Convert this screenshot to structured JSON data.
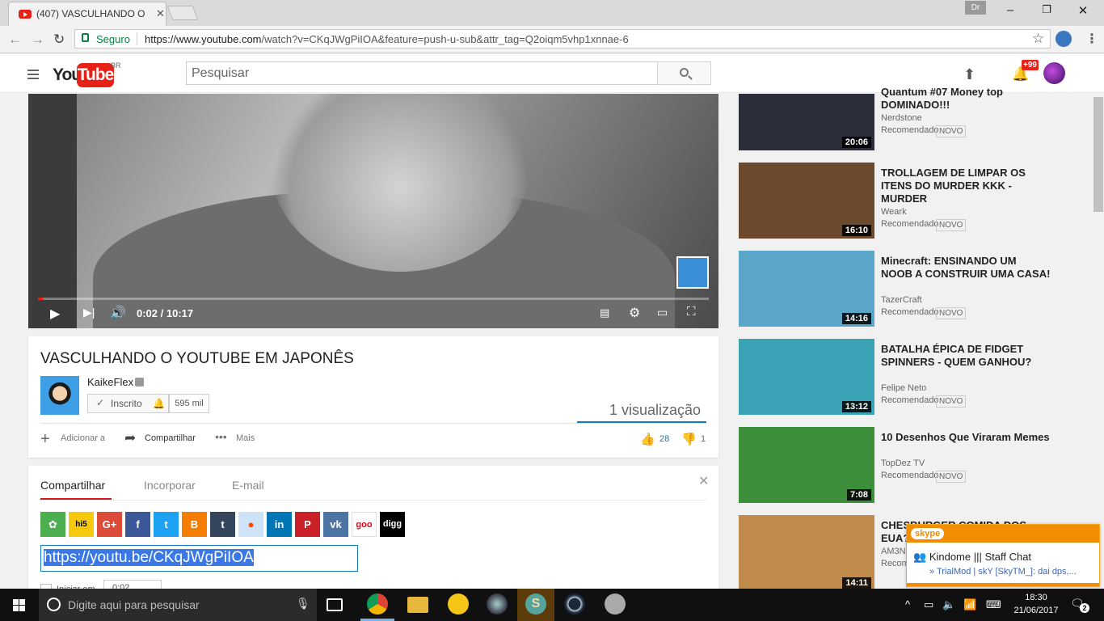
{
  "browser": {
    "tab_title": "(407) VASCULHANDO O",
    "profile": "Dr",
    "secure_label": "Seguro",
    "url_scheme_host": "https://www.youtube.com",
    "url_rest": "/watch?v=CKqJWgPiIOA&feature=push-u-sub&attr_tag=Q2oiqm5vhp1xnnae-6",
    "icons": [
      "youtube-favicon",
      "back-icon",
      "forward-icon",
      "reload-icon",
      "lock-icon",
      "star-icon",
      "menu-icon"
    ]
  },
  "header": {
    "logo_you": "You",
    "logo_tube": "Tube",
    "logo_region": "BR",
    "search_placeholder": "Pesquisar",
    "notification_badge": "+99"
  },
  "player": {
    "time": "0:02 / 10:17",
    "progress_fraction": 0.003
  },
  "video": {
    "title": "VASCULHANDO O YOUTUBE EM JAPONÊS",
    "channel": "KaikeFlex",
    "subscribe_label": "Inscrito",
    "subscriber_count": "595 mil",
    "views": "1 visualização",
    "add_label": "Adicionar a",
    "share_label": "Compartilhar",
    "more_label": "Mais",
    "likes": "28",
    "dislikes": "1"
  },
  "share": {
    "tabs": [
      "Compartilhar",
      "Incorporar",
      "E-mail"
    ],
    "short_url": "https://youtu.be/CKqJWgPiIOA",
    "start_label": "Iniciar em",
    "start_value": "0:02",
    "networks": [
      {
        "name": "ameba",
        "glyph": "✿",
        "color": "#4bae4f"
      },
      {
        "name": "hi5",
        "glyph": "hi5",
        "color": "#f7c90d"
      },
      {
        "name": "google-plus",
        "glyph": "G+",
        "color": "#dd4b39"
      },
      {
        "name": "facebook",
        "glyph": "f",
        "color": "#3b5998"
      },
      {
        "name": "twitter",
        "glyph": "t",
        "color": "#1da1f2"
      },
      {
        "name": "blogger",
        "glyph": "B",
        "color": "#f57d00"
      },
      {
        "name": "tumblr",
        "glyph": "t",
        "color": "#35465c"
      },
      {
        "name": "reddit",
        "glyph": "●",
        "color": "#cee3f8"
      },
      {
        "name": "linkedin",
        "glyph": "in",
        "color": "#0077b5"
      },
      {
        "name": "pinterest",
        "glyph": "P",
        "color": "#cb2027"
      },
      {
        "name": "vk",
        "glyph": "vk",
        "color": "#4c75a3"
      },
      {
        "name": "goo",
        "glyph": "goo",
        "color": "#ffffff"
      },
      {
        "name": "digg",
        "glyph": "digg",
        "color": "#000000"
      }
    ]
  },
  "recommendations": [
    {
      "title": "Quantum #07 Money top DOMINADO!!!",
      "channel": "Nerdstone",
      "meta": "Recomendado",
      "badge": "NOVO",
      "duration": "20:06",
      "thumb": "#2b2d3a"
    },
    {
      "title": "TROLLAGEM DE LIMPAR OS ITENS DO MURDER KKK - MURDER",
      "channel": "Weark",
      "meta": "Recomendado",
      "badge": "NOVO",
      "duration": "16:10",
      "thumb": "#6b4a2e"
    },
    {
      "title": "Minecraft: ENSINANDO UM NOOB A CONSTRUIR UMA CASA!",
      "channel": "TazerCraft",
      "meta": "Recomendado",
      "badge": "NOVO",
      "duration": "14:16",
      "thumb": "#5aa6c9"
    },
    {
      "title": "BATALHA ÉPICA DE FIDGET SPINNERS - QUEM GANHOU?",
      "channel": "Felipe Neto",
      "meta": "Recomendado",
      "badge": "NOVO",
      "duration": "13:12",
      "thumb": "#3aa3b5"
    },
    {
      "title": "10 Desenhos Que Viraram Memes",
      "channel": "TopDez TV",
      "meta": "Recomendado",
      "badge": "NOVO",
      "duration": "7:08",
      "thumb": "#3c8e3a"
    },
    {
      "title": "CHESBURGER COMIDA DOS EUA?",
      "channel": "AM3N",
      "meta": "Recom",
      "badge": "",
      "duration": "14:11",
      "thumb": "#c08a4a"
    }
  ],
  "skype": {
    "brand": "skype",
    "room": "Kindome ||| Staff Chat",
    "message": "» TrialMod | skY [SkyTM_]: dai dps,..."
  },
  "taskbar": {
    "search_placeholder": "Digite aqui para pesquisar",
    "time": "18:30",
    "date": "21/06/2017",
    "notifications": "2"
  }
}
